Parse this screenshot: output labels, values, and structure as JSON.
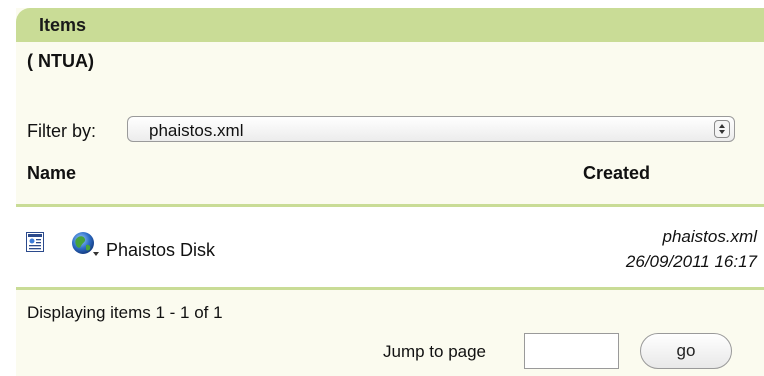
{
  "header": {
    "title": "Items"
  },
  "organization": "( NTUA)",
  "filter": {
    "label": "Filter by:",
    "selected": "phaistos.xml"
  },
  "columns": {
    "name": "Name",
    "created": "Created"
  },
  "items": [
    {
      "title": "Phaistos Disk",
      "file": "phaistos.xml",
      "created": "26/09/2011 16:17",
      "icons": [
        "document-icon",
        "globe-icon"
      ]
    }
  ],
  "pagination": {
    "summary": "Displaying items 1 - 1 of 1",
    "jump_label": "Jump to page",
    "jump_value": "",
    "go_label": "go"
  },
  "colors": {
    "header_bg": "#c9dc96",
    "panel_bg": "#fbfbef"
  }
}
